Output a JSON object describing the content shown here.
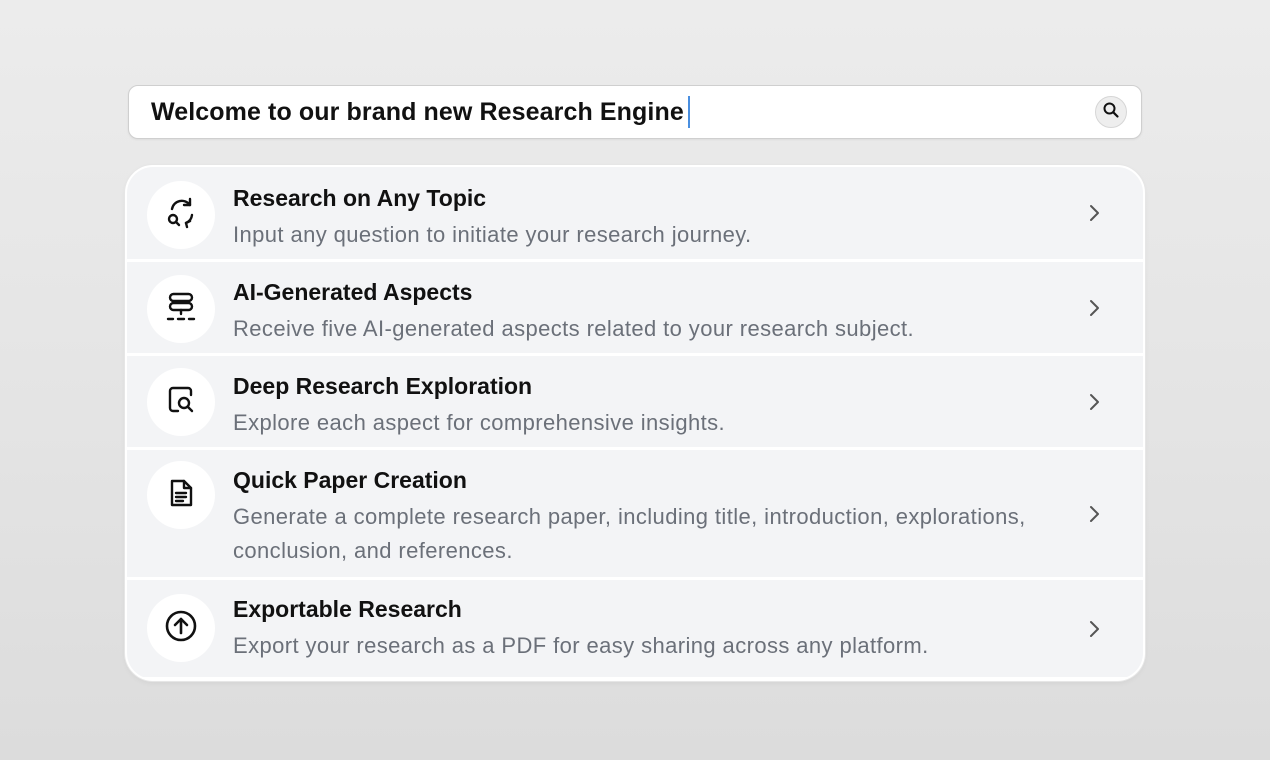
{
  "search": {
    "value": "Welcome to our brand new Research Engine"
  },
  "features": [
    {
      "title": "Research on Any Topic",
      "description": "Input any question to initiate your research journey.",
      "icon": "refresh-search-icon"
    },
    {
      "title": "AI-Generated Aspects",
      "description": "Receive five AI-generated aspects related to your research subject.",
      "icon": "layers-split-icon"
    },
    {
      "title": "Deep Research Exploration",
      "description": "Explore each aspect for comprehensive insights.",
      "icon": "document-search-icon"
    },
    {
      "title": "Quick Paper Creation",
      "description": "Generate a complete research paper, including title, introduction, explorations, conclusion, and references.",
      "icon": "document-lines-icon"
    },
    {
      "title": "Exportable Research",
      "description": "Export your research as a PDF for easy sharing across any platform.",
      "icon": "arrow-up-circle-icon"
    }
  ],
  "colors": {
    "caret": "#4a8fe0",
    "row_background": "#f3f4f6",
    "description_text": "#6b7079"
  }
}
